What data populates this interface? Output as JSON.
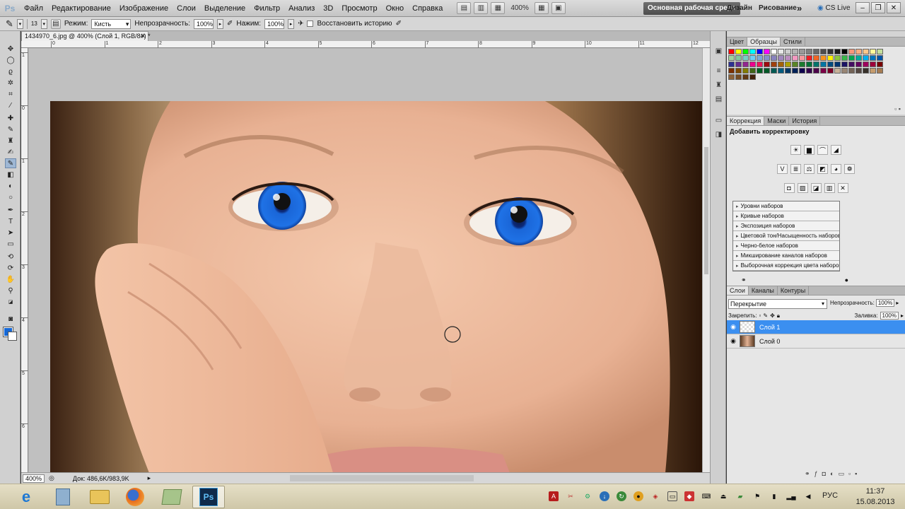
{
  "app": {
    "badge": "Ps",
    "menu": [
      "Файл",
      "Редактирование",
      "Изображение",
      "Слои",
      "Выделение",
      "Фильтр",
      "Анализ",
      "3D",
      "Просмотр",
      "Окно",
      "Справка"
    ],
    "zoom_display": "400%",
    "workspace": {
      "active": "Основная рабочая среда",
      "design": "Дизайн",
      "painting": "Рисование",
      "more": "»"
    },
    "cs_live": "CS Live"
  },
  "options": {
    "brush_size": "13",
    "mode_label": "Режим:",
    "mode_value": "Кисть",
    "opacity_label": "Непрозрачность:",
    "opacity_value": "100%",
    "pressure_label": "Нажим:",
    "pressure_value": "100%",
    "restore_label": "Восстановить историю"
  },
  "document": {
    "tab_title": "1434970_6.jpg @ 400% (Слой 1, RGB/8#) *",
    "ruler_top": [
      "0",
      "1",
      "2",
      "3",
      "4",
      "5",
      "6",
      "7",
      "8",
      "9",
      "10",
      "11",
      "12"
    ],
    "ruler_left": [
      "1",
      "0",
      "1",
      "2",
      "3",
      "4",
      "5",
      "6"
    ],
    "status_zoom": "400%",
    "status_doc": "Док: 486,6K/983,9K"
  },
  "panels": {
    "swatches_tabs": [
      "Цвет",
      "Образцы",
      "Стили"
    ],
    "correction_tabs": [
      "Коррекция",
      "Маски",
      "История"
    ],
    "correction_title": "Добавить корректировку",
    "presets": [
      "Уровни наборов",
      "Кривые наборов",
      "Экспозиция наборов",
      "Цветовой тон/Насыщенность наборов",
      "Черно-белое наборов",
      "Микширование каналов наборов",
      "Выборочная коррекция цвета наборов"
    ],
    "layers_tabs": [
      "Слои",
      "Каналы",
      "Контуры"
    ],
    "blend_mode": "Перекрытие",
    "opacity_label": "Непрозрачность:",
    "opacity_value": "100%",
    "lock_label": "Закрепить:",
    "fill_label": "Заливка:",
    "fill_value": "100%",
    "layers": [
      {
        "name": "Слой 1",
        "selected": true
      },
      {
        "name": "Слой 0",
        "selected": false
      }
    ]
  },
  "taskbar": {
    "language": "РУС",
    "time": "11:37",
    "date": "15.08.2013"
  },
  "colors": {
    "foreground": "#1668d6",
    "background": "#ffffff",
    "selection": "#3b8ff0",
    "iris": "#1a66d8"
  }
}
